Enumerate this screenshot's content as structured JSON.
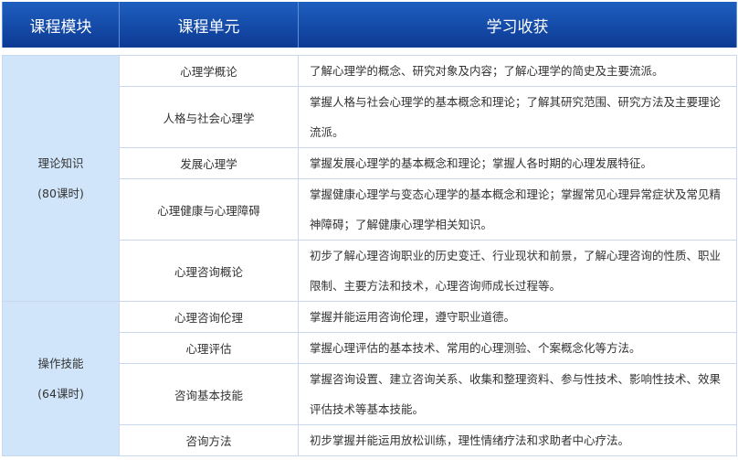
{
  "header": {
    "col_module": "课程模块",
    "col_unit": "课程单元",
    "col_outcome": "学习收获"
  },
  "modules": [
    {
      "name": "理论知识",
      "hours": "(80课时)",
      "units": [
        {
          "unit": "心理学概论",
          "outcome": "了解心理学的概念、研究对象及内容；了解心理学的简史及主要流派。"
        },
        {
          "unit": "人格与社会心理学",
          "outcome": "掌握人格与社会心理学的基本概念和理论；了解其研究范围、研究方法及主要理论流派。"
        },
        {
          "unit": "发展心理学",
          "outcome": "掌握发展心理学的基本概念和理论；掌握人各时期的心理发展特征。"
        },
        {
          "unit": "心理健康与心理障碍",
          "outcome": "掌握健康心理学与变态心理学的基本概念和理论；掌握常见心理异常症状及常见精神障碍；了解健康心理学相关知识。"
        },
        {
          "unit": "心理咨询概论",
          "outcome": "初步了解心理咨询职业的历史变迁、行业现状和前景，了解心理咨询的性质、职业限制、主要方法和技术，心理咨询师成长过程等。"
        }
      ]
    },
    {
      "name": "操作技能",
      "hours": "(64课时)",
      "units": [
        {
          "unit": "心理咨询伦理",
          "outcome": "掌握并能运用咨询伦理，遵守职业道德。"
        },
        {
          "unit": "心理评估",
          "outcome": "掌握心理评估的基本技术、常用的心理测验、个案概念化等方法。"
        },
        {
          "unit": "咨询基本技能",
          "outcome": "掌握咨询设置、建立咨询关系、收集和整理资料、参与性技术、影响性技术、效果评估技术等基本技能。"
        },
        {
          "unit": "咨询方法",
          "outcome": "初步掌握并能运用放松训练，理性情绪疗法和求助者中心疗法。"
        }
      ]
    }
  ]
}
